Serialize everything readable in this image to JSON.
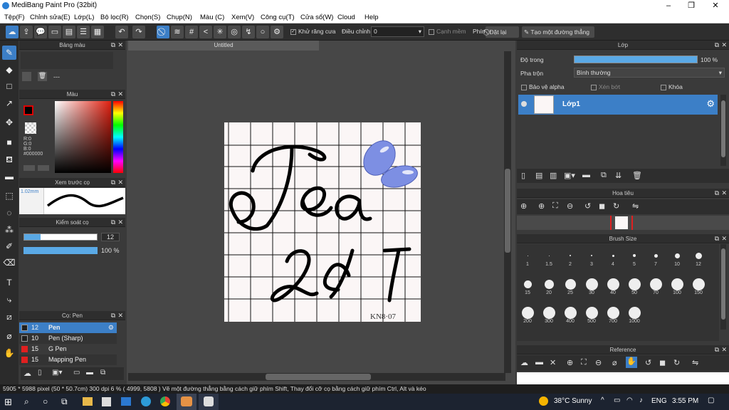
{
  "app": {
    "title": "MediBang Paint Pro (32bit)"
  },
  "menu": [
    "Tệp(F)",
    "Chỉnh sửa(E)",
    "Lớp(L)",
    "Bộ lọc(R)",
    "Chọn(S)",
    "Chụp(N)",
    "Màu (C)",
    "Xem(V)",
    "Công cụ(T)",
    "Cửa sổ(W)",
    "Cloud",
    "Help"
  ],
  "toolbar": {
    "antialias": "Khử răng cưa",
    "adjust_label": "Điều chỉnh",
    "adjust_value": "0",
    "soft_edge": "Cạnh mềm",
    "key_label": "Phím",
    "reset": "Đặt lại",
    "straight": "Tạo một đường thẳng"
  },
  "panels": {
    "colorbar": {
      "title": "Bảng màu",
      "placeholder": "---"
    },
    "color": {
      "title": "Màu",
      "r": "R:0",
      "g": "G:0",
      "b": "B:0",
      "hex": "#000000"
    },
    "preview": {
      "title": "Xem trước cọ",
      "size": "1.02mm"
    },
    "brushctrl": {
      "title": "Kiểm soát cọ",
      "size": "12",
      "opacity": "100 %"
    },
    "brush": {
      "title": "Cọ: Pen",
      "items": [
        {
          "size": "12",
          "name": "Pen",
          "color": "#1f1f1f"
        },
        {
          "size": "10",
          "name": "Pen (Sharp)",
          "color": "#1f1f1f"
        },
        {
          "size": "15",
          "name": "G Pen",
          "color": "#e02020"
        },
        {
          "size": "15",
          "name": "Mapping Pen",
          "color": "#e02020"
        }
      ]
    },
    "layer": {
      "title": "Lớp",
      "opacity_label": "Độ trong",
      "opacity_value": "100 %",
      "blend_label": "Pha trộn",
      "blend_value": "Bình thường",
      "protect_alpha": "Bảo vệ alpha",
      "clipping": "Xén bớt",
      "lock": "Khóa",
      "layer_name": "Lớp1"
    },
    "navigator": {
      "title": "Hoa tiêu"
    },
    "brushsize": {
      "title": "Brush Size",
      "sizes": [
        "1",
        "1.5",
        "2",
        "3",
        "4",
        "5",
        "7",
        "10",
        "12",
        "15",
        "20",
        "25",
        "30",
        "40",
        "50",
        "70",
        "100",
        "150",
        "200",
        "300",
        "400",
        "500",
        "700",
        "1000"
      ]
    },
    "reference": {
      "title": "Reference"
    }
  },
  "document": {
    "tab": "Untitled",
    "text1": "Tea",
    "text2": "247",
    "signature": "KN8·07"
  },
  "status": "5905 * 5988 pixel  (50 * 50.7cm)  300 dpi  6 %  ( 4999, 5808 )  Vẽ một đường thẳng bằng cách giữ phím Shift, Thay đổi cỡ cọ bằng cách giữ phím Ctrl, Alt và kéo",
  "taskbar": {
    "weather": "38°C  Sunny",
    "lang": "ENG",
    "time": "3:55 PM"
  },
  "colors": {
    "accent": "#3c7fc7",
    "blue_shape": "#7d8fe3"
  }
}
